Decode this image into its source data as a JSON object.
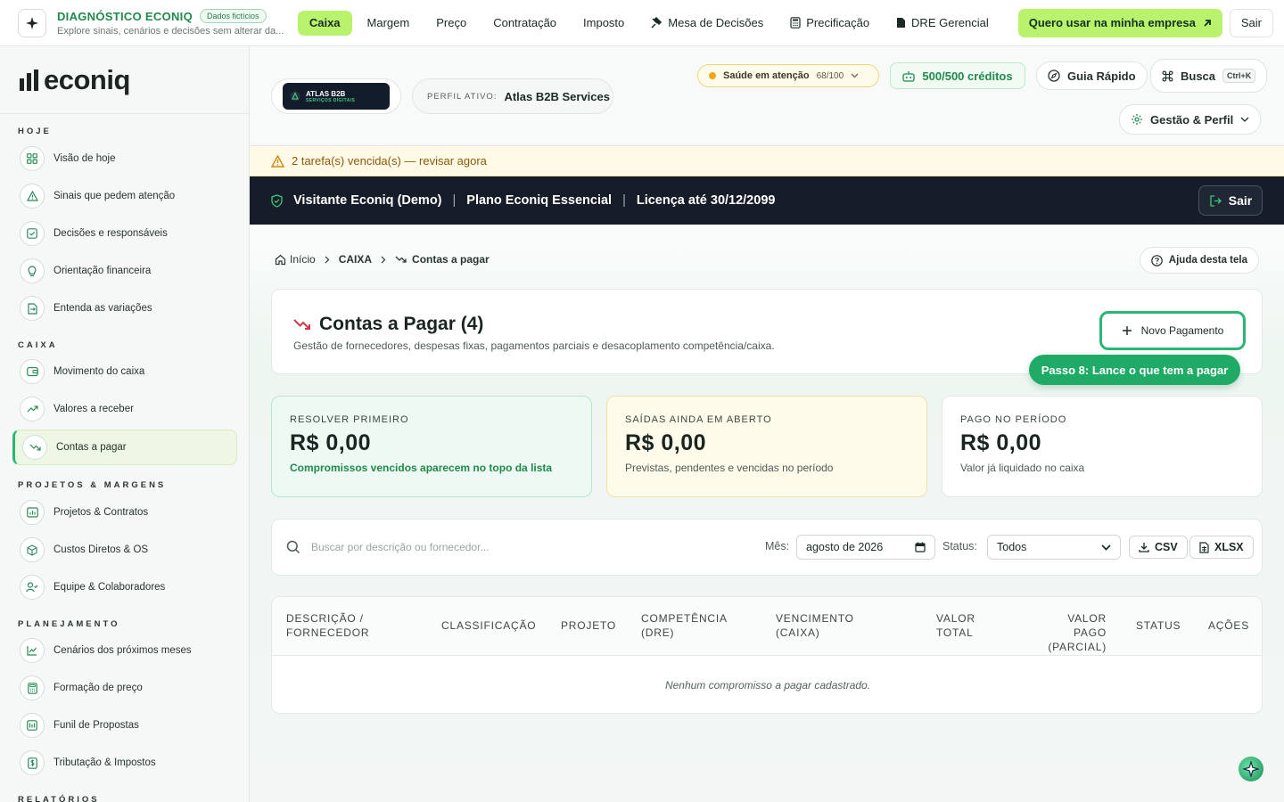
{
  "topbar": {
    "diag_title": "DIAGNÓSTICO ECONIQ",
    "diag_badge": "Dados fictícios",
    "diag_subtitle": "Explore sinais, cenários e decisões sem alterar da...",
    "nav": [
      {
        "label": "Caixa",
        "active": true
      },
      {
        "label": "Margem"
      },
      {
        "label": "Preço"
      },
      {
        "label": "Contratação"
      },
      {
        "label": "Imposto"
      },
      {
        "label": "Mesa de Decisões",
        "icon": "gavel-icon"
      },
      {
        "label": "Precificação",
        "icon": "calculator-icon"
      },
      {
        "label": "DRE Gerencial",
        "icon": "document-icon"
      }
    ],
    "cta_label": "Quero usar na minha empresa",
    "exit_label": "Sair"
  },
  "sidebar": {
    "logo": "econiq",
    "sections": [
      {
        "title": "HOJE",
        "items": [
          {
            "label": "Visão de hoje",
            "icon": "grid-icon"
          },
          {
            "label": "Sinais que pedem atenção",
            "icon": "warning-icon"
          },
          {
            "label": "Decisões e responsáveis",
            "icon": "check-square-icon"
          },
          {
            "label": "Orientação financeira",
            "icon": "lightbulb-icon"
          },
          {
            "label": "Entenda as variações",
            "icon": "file-swap-icon"
          }
        ]
      },
      {
        "title": "CAIXA",
        "items": [
          {
            "label": "Movimento do caixa",
            "icon": "wallet-icon"
          },
          {
            "label": "Valores a receber",
            "icon": "trend-up-icon"
          },
          {
            "label": "Contas a pagar",
            "icon": "trend-down-icon",
            "active": true
          }
        ]
      },
      {
        "title": "PROJETOS & MARGENS",
        "items": [
          {
            "label": "Projetos & Contratos",
            "icon": "folder-chart-icon"
          },
          {
            "label": "Custos Diretos & OS",
            "icon": "box-icon"
          },
          {
            "label": "Equipe & Colaboradores",
            "icon": "user-check-icon"
          }
        ]
      },
      {
        "title": "PLANEJAMENTO",
        "items": [
          {
            "label": "Cenários dos próximos meses",
            "icon": "line-chart-icon"
          },
          {
            "label": "Formação de preço",
            "icon": "calculator-icon"
          },
          {
            "label": "Funil de Propostas",
            "icon": "funnel-chart-icon"
          },
          {
            "label": "Tributação & Impostos",
            "icon": "dollar-file-icon"
          }
        ]
      },
      {
        "title": "RELATÓRIOS",
        "items": []
      }
    ]
  },
  "header": {
    "company_name": "ATLAS B2B",
    "company_tagline": "SERVIÇOS DIGITAIS",
    "profile_label": "PERFIL ATIVO:",
    "profile_value": "Atlas B2B Services",
    "health_label": "Saúde em atenção",
    "health_score": "68/100",
    "credits_label": "500/500 créditos",
    "guide_label": "Guia Rápido",
    "search_label": "Busca",
    "search_shortcut": "Ctrl+K",
    "settings_label": "Gestão & Perfil"
  },
  "alert": {
    "text": "2 tarefa(s) vencida(s) — revisar agora"
  },
  "license_bar": {
    "visitor": "Visitante Econiq (Demo)",
    "plan": "Plano Econiq Essencial",
    "license": "Licença até 30/12/2099",
    "exit": "Sair"
  },
  "breadcrumb": {
    "home": "Início",
    "section": "CAIXA",
    "current": "Contas a pagar"
  },
  "help_label": "Ajuda desta tela",
  "page": {
    "title": "Contas a Pagar (4)",
    "subtitle": "Gestão de fornecedores, despesas fixas, pagamentos parciais e desacoplamento competência/caixa.",
    "new_button": "Novo Pagamento",
    "tip": "Passo 8: Lance o que tem a pagar"
  },
  "kpis": [
    {
      "label": "RESOLVER PRIMEIRO",
      "value": "R$ 0,00",
      "note": "Compromissos vencidos aparecem no topo da lista"
    },
    {
      "label": "SAÍDAS AINDA EM ABERTO",
      "value": "R$ 0,00",
      "note": "Previstas, pendentes e vencidas no período"
    },
    {
      "label": "PAGO NO PERÍODO",
      "value": "R$ 0,00",
      "note": "Valor já liquidado no caixa"
    }
  ],
  "filters": {
    "search_placeholder": "Buscar por descrição ou fornecedor...",
    "month_label": "Mês:",
    "month_value": "agosto de 2026",
    "status_label": "Status:",
    "status_value": "Todos",
    "csv_label": "CSV",
    "xlsx_label": "XLSX"
  },
  "table": {
    "columns": [
      [
        "DESCRIÇÃO /",
        "FORNECEDOR"
      ],
      [
        "CLASSIFICAÇÃO",
        ""
      ],
      [
        "PROJETO",
        ""
      ],
      [
        "COMPETÊNCIA",
        "(DRE)"
      ],
      [
        "VENCIMENTO",
        "(CAIXA)"
      ],
      [
        "VALOR",
        "TOTAL"
      ],
      [
        "VALOR PAGO",
        "(PARCIAL)"
      ],
      [
        "STATUS",
        ""
      ],
      [
        "AÇÕES",
        ""
      ]
    ],
    "empty_message": "Nenhum compromisso a pagar cadastrado."
  }
}
